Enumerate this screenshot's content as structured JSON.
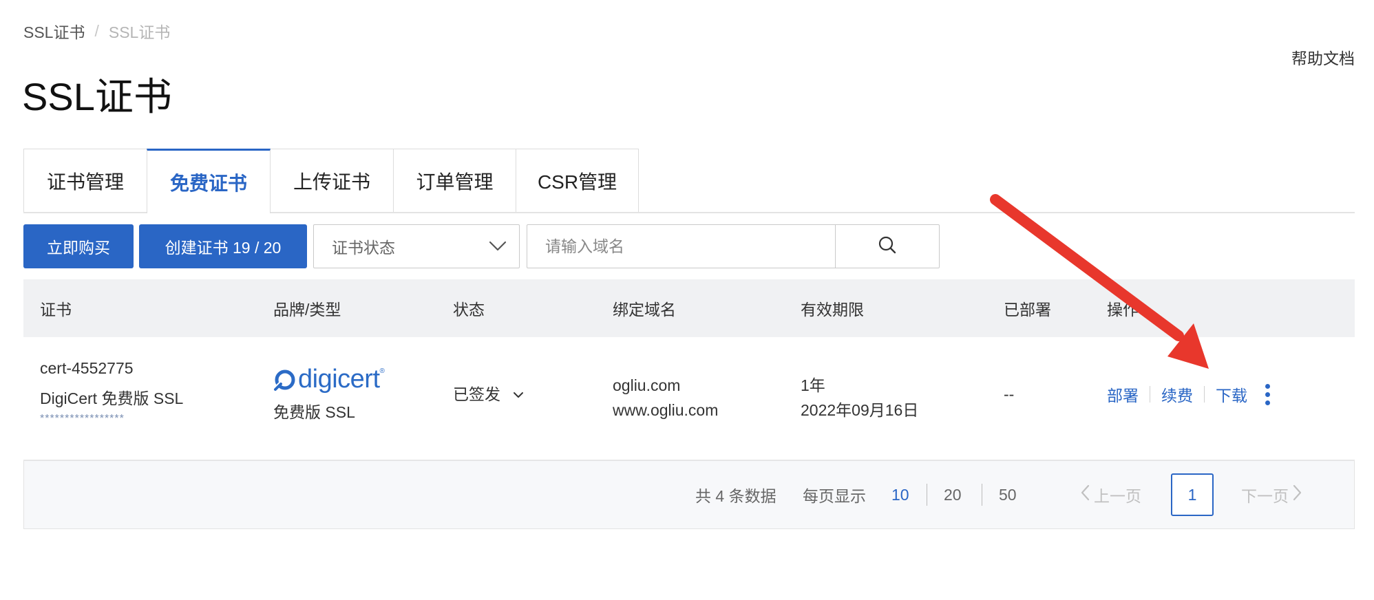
{
  "breadcrumb": {
    "root": "SSL证书",
    "separator": "/",
    "current": "SSL证书"
  },
  "help_link": "帮助文档",
  "page_title": "SSL证书",
  "tabs": [
    {
      "label": "证书管理",
      "active": false
    },
    {
      "label": "免费证书",
      "active": true
    },
    {
      "label": "上传证书",
      "active": false
    },
    {
      "label": "订单管理",
      "active": false
    },
    {
      "label": "CSR管理",
      "active": false
    }
  ],
  "toolbar": {
    "buy_label": "立即购买",
    "create_label": "创建证书 19 / 20",
    "status_select": "证书状态",
    "search_placeholder": "请输入域名"
  },
  "table": {
    "columns": [
      "证书",
      "品牌/类型",
      "状态",
      "绑定域名",
      "有效期限",
      "已部署",
      "操作"
    ],
    "rows": [
      {
        "cert_id": "cert-4552775",
        "cert_name": "DigiCert 免费版 SSL",
        "cert_mask": "*****************",
        "brand_logo": "digicert",
        "brand_logo_icon": "digicert-logo-icon",
        "brand_type": "免费版 SSL",
        "status": "已签发",
        "domain_1": "ogliu.com",
        "domain_2": "www.ogliu.com",
        "validity_period": "1年",
        "validity_date": "2022年09月16日",
        "deployed": "--",
        "actions": {
          "deploy": "部署",
          "renew": "续费",
          "download": "下载"
        }
      }
    ]
  },
  "pagination": {
    "total": "共 4 条数据",
    "page_size_label": "每页显示",
    "page_sizes": [
      "10",
      "20",
      "50"
    ],
    "active_page_size": "10",
    "prev": "上一页",
    "current_page": "1",
    "next": "下一页"
  },
  "colors": {
    "primary": "#2a66c5",
    "annotation_arrow": "#e8372c"
  }
}
